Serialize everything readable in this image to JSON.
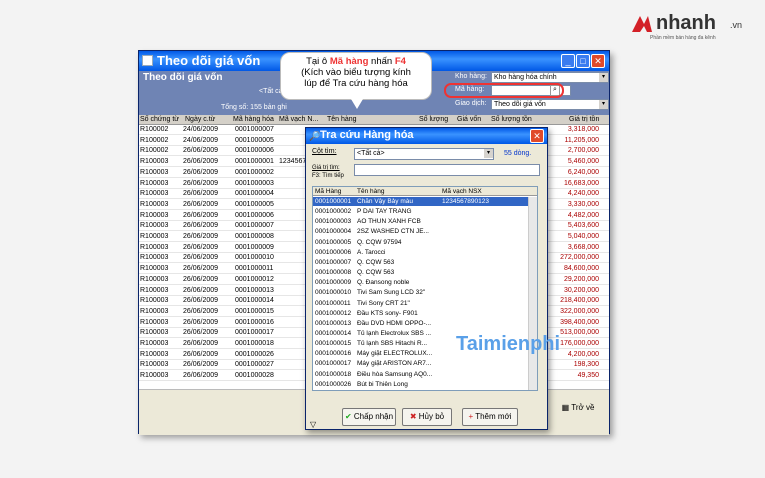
{
  "logo": {
    "name": "nhanh",
    "tld": ".vn",
    "tagline": "Phần mềm bán hàng đa kênh"
  },
  "window": {
    "title": "Theo dõi giá vốn",
    "header_title": "Theo dõi giá vốn",
    "all_label": "<Tất cả",
    "total_label": "Tổng số: 155 bản ghi",
    "kho_label": "Kho hàng:",
    "kho_value": "Kho hàng hóa chính",
    "ma_hang_label": "Mã hàng:",
    "giao_dich_label": "Giao dịch:",
    "giao_dich_value": "Theo dõi giá vốn",
    "columns": [
      "Số chứng từ",
      "Ngày c.từ",
      "Mã hàng hóa",
      "Mã vạch N...",
      "Tên hàng",
      "Số lượng",
      "Giá vốn",
      "Số lượng tồn",
      "Giá trị tồn"
    ],
    "rows": [
      [
        "R100002",
        "24/06/2009",
        "0001000007",
        "",
        "3,318,000"
      ],
      [
        "R100002",
        "24/06/2009",
        "0001000005",
        "",
        "11,205,000"
      ],
      [
        "R100002",
        "26/06/2009",
        "0001000006",
        "",
        "2,700,000"
      ],
      [
        "R100003",
        "26/06/2009",
        "0001000001",
        "1234567",
        "5,460,000"
      ],
      [
        "R100003",
        "26/06/2009",
        "0001000002",
        "",
        "6,240,000"
      ],
      [
        "R100003",
        "26/06/2009",
        "0001000003",
        "",
        "16,683,000"
      ],
      [
        "R100003",
        "26/06/2009",
        "0001000004",
        "",
        "4,240,000"
      ],
      [
        "R100003",
        "26/06/2009",
        "0001000005",
        "",
        "3,330,000"
      ],
      [
        "R100003",
        "26/06/2009",
        "0001000006",
        "",
        "4,482,000"
      ],
      [
        "R100003",
        "26/06/2009",
        "0001000007",
        "",
        "5,403,600"
      ],
      [
        "R100003",
        "26/06/2009",
        "0001000008",
        "",
        "5,040,000"
      ],
      [
        "R100003",
        "26/06/2009",
        "0001000009",
        "",
        "3,668,000"
      ],
      [
        "R100003",
        "26/06/2009",
        "0001000010",
        "",
        "272,000,000"
      ],
      [
        "R100003",
        "26/06/2009",
        "0001000011",
        "",
        "84,600,000"
      ],
      [
        "R100003",
        "26/06/2009",
        "0001000012",
        "",
        "29,200,000"
      ],
      [
        "R100003",
        "26/06/2009",
        "0001000013",
        "",
        "30,200,000"
      ],
      [
        "R100003",
        "26/06/2009",
        "0001000014",
        "",
        "218,400,000"
      ],
      [
        "R100003",
        "26/06/2009",
        "0001000015",
        "",
        "322,000,000"
      ],
      [
        "R100003",
        "26/06/2009",
        "0001000016",
        "",
        "398,400,000"
      ],
      [
        "R100003",
        "26/06/2009",
        "0001000017",
        "",
        "513,000,000"
      ],
      [
        "R100003",
        "26/06/2009",
        "0001000018",
        "",
        "176,000,000"
      ],
      [
        "R100003",
        "26/06/2009",
        "0001000026",
        "",
        "4,200,000"
      ],
      [
        "R100003",
        "26/06/2009",
        "0001000027",
        "",
        "198,300"
      ],
      [
        "R100003",
        "26/06/2009",
        "0001000028",
        "",
        "49,350"
      ]
    ],
    "back_button": "Trở về"
  },
  "dialog": {
    "title": "Tra cứu Hàng hóa",
    "search_col_label": "Cột tìm:",
    "search_col_value": "<Tất cả>",
    "row_count": "55 dòng.",
    "search_value_label": "Giá trị tìm:",
    "hint": "F3: Tìm tiếp",
    "list_columns": [
      "Mã Hàng",
      "Tên hàng",
      "Mã vạch NSX"
    ],
    "items": [
      [
        "0001000001",
        "Chăn Vậy Bảy màu",
        "1234567890123"
      ],
      [
        "0001000002",
        "P DAI TAY TRANG",
        ""
      ],
      [
        "0001000003",
        "AO THUN XANH FCB",
        ""
      ],
      [
        "0001000004",
        "2SZ WASHED CTN JE...",
        ""
      ],
      [
        "0001000005",
        "Q. CQW 97594",
        ""
      ],
      [
        "0001000006",
        "A. Tarocci",
        ""
      ],
      [
        "0001000007",
        "Q. CQW 563",
        ""
      ],
      [
        "0001000008",
        "Q. CQW 563",
        ""
      ],
      [
        "0001000009",
        "Q. Đansong noble",
        ""
      ],
      [
        "0001000010",
        "Tivi Sam Sung LCD 32\"",
        ""
      ],
      [
        "0001000011",
        "Tivi Sony CRT 21\"",
        ""
      ],
      [
        "0001000012",
        "Đầu KTS sony- F901",
        ""
      ],
      [
        "0001000013",
        "Đầu DVD HDMI OPPO-...",
        ""
      ],
      [
        "0001000014",
        "Tủ lạnh Electrolux SBS ...",
        ""
      ],
      [
        "0001000015",
        "Tủ lạnh SBS Hitachi R...",
        ""
      ],
      [
        "0001000016",
        "Máy giặt ELECTROLUX...",
        ""
      ],
      [
        "0001000017",
        "Máy giặt ARISTON AR7...",
        ""
      ],
      [
        "0001000018",
        "Điều hòa Samsung AQ0...",
        ""
      ],
      [
        "0001000026",
        "Bút bi Thiên Long",
        ""
      ]
    ],
    "accept_button": "Chấp nhận",
    "cancel_button": "Hủy bỏ",
    "add_button": "Thêm mới"
  },
  "callout": {
    "line1_prefix": "Tại ô ",
    "line1_highlight1": "Mã hàng",
    "line1_mid": " nhấn ",
    "line1_highlight2": "F4",
    "line2": "(Kích vào biểu tượng kính",
    "line3": "lúp để Tra cứu hàng hóa"
  },
  "watermark": "Taimienphi"
}
